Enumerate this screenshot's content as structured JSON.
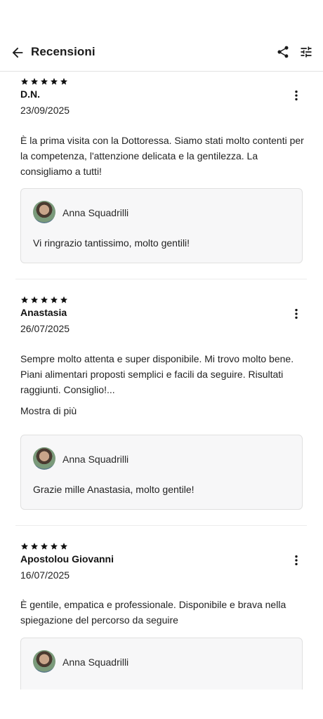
{
  "header": {
    "title": "Recensioni",
    "back_icon": "arrow-left-icon",
    "share_icon": "share-icon",
    "filter_icon": "sliders-icon"
  },
  "reviews": [
    {
      "rating": 5,
      "name": "D.N.",
      "date": "23/09/2025",
      "text": "È la prima visita con la Dottoressa. Siamo stati molto contenti per la competenza, l'attenzione delicata e la gentilezza. La consigliamo a tutti!",
      "show_more": "",
      "reply": {
        "author": "Anna Squadrilli",
        "text": "Vi ringrazio tantissimo, molto gentili!"
      }
    },
    {
      "rating": 5,
      "name": "Anastasia",
      "date": "26/07/2025",
      "text": "Sempre molto attenta e super disponibile. Mi trovo molto bene. Piani alimentari proposti semplici e facili da seguire. Risultati raggiunti. Consiglio!...",
      "show_more": "Mostra di più",
      "reply": {
        "author": "Anna Squadrilli",
        "text": "Grazie mille Anastasia, molto gentile!"
      }
    },
    {
      "rating": 5,
      "name": "Apostolou Giovanni",
      "date": "16/07/2025",
      "text": "È gentile, empatica e professionale. Disponibile e brava nella spiegazione del percorso da seguire",
      "show_more": "",
      "reply": {
        "author": "Anna Squadrilli",
        "text": ""
      }
    }
  ],
  "colors": {
    "text": "#1f1f1f",
    "reply_bg": "#f7f7f8",
    "divider": "#ececec"
  }
}
